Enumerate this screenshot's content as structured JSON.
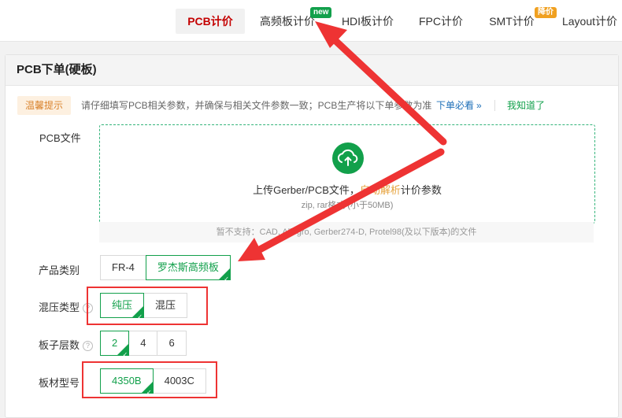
{
  "nav": {
    "tabs": [
      {
        "label": "PCB计价",
        "active": true
      },
      {
        "label": "高频板计价",
        "badge": "new"
      },
      {
        "label": "HDI板计价"
      },
      {
        "label": "FPC计价"
      },
      {
        "label": "SMT计价",
        "badge": "降价"
      },
      {
        "label": "Layout计价"
      }
    ]
  },
  "card": {
    "title": "PCB下单(硬板)",
    "tip": {
      "tag": "温馨提示",
      "text": "请仔细填写PCB相关参数，并确保与相关文件参数一致；PCB生产将以下单参数为准",
      "link": "下单必看",
      "link_arrow": "»",
      "dismiss": "我知道了"
    },
    "file": {
      "label": "PCB文件",
      "upload_title_prefix": "上传Gerber/PCB文件，",
      "upload_title_highlight": "自动解析",
      "upload_title_suffix": "计价参数",
      "upload_sub": "zip, rar格式 (小于50MB)",
      "unsupported": "暂不支持：CAD, Allegro, Gerber274-D, Protel98(及以下版本)的文件"
    },
    "product_type": {
      "label": "产品类别",
      "options": [
        "FR-4",
        "罗杰斯高频板"
      ],
      "selected": "罗杰斯高频板"
    },
    "lamination": {
      "label": "混压类型",
      "help_icon": "?",
      "options": [
        "纯压",
        "混压"
      ],
      "selected": "纯压"
    },
    "layers": {
      "label": "板子层数",
      "help_icon": "?",
      "options": [
        "2",
        "4",
        "6"
      ],
      "selected": "2"
    },
    "material": {
      "label": "板材型号",
      "options": [
        "4350B",
        "4003C"
      ],
      "selected": "4350B"
    }
  },
  "colors": {
    "accent": "#12a04b",
    "active_tab": "#c40000",
    "annotation": "#e33333",
    "link": "#1d6fb8"
  }
}
